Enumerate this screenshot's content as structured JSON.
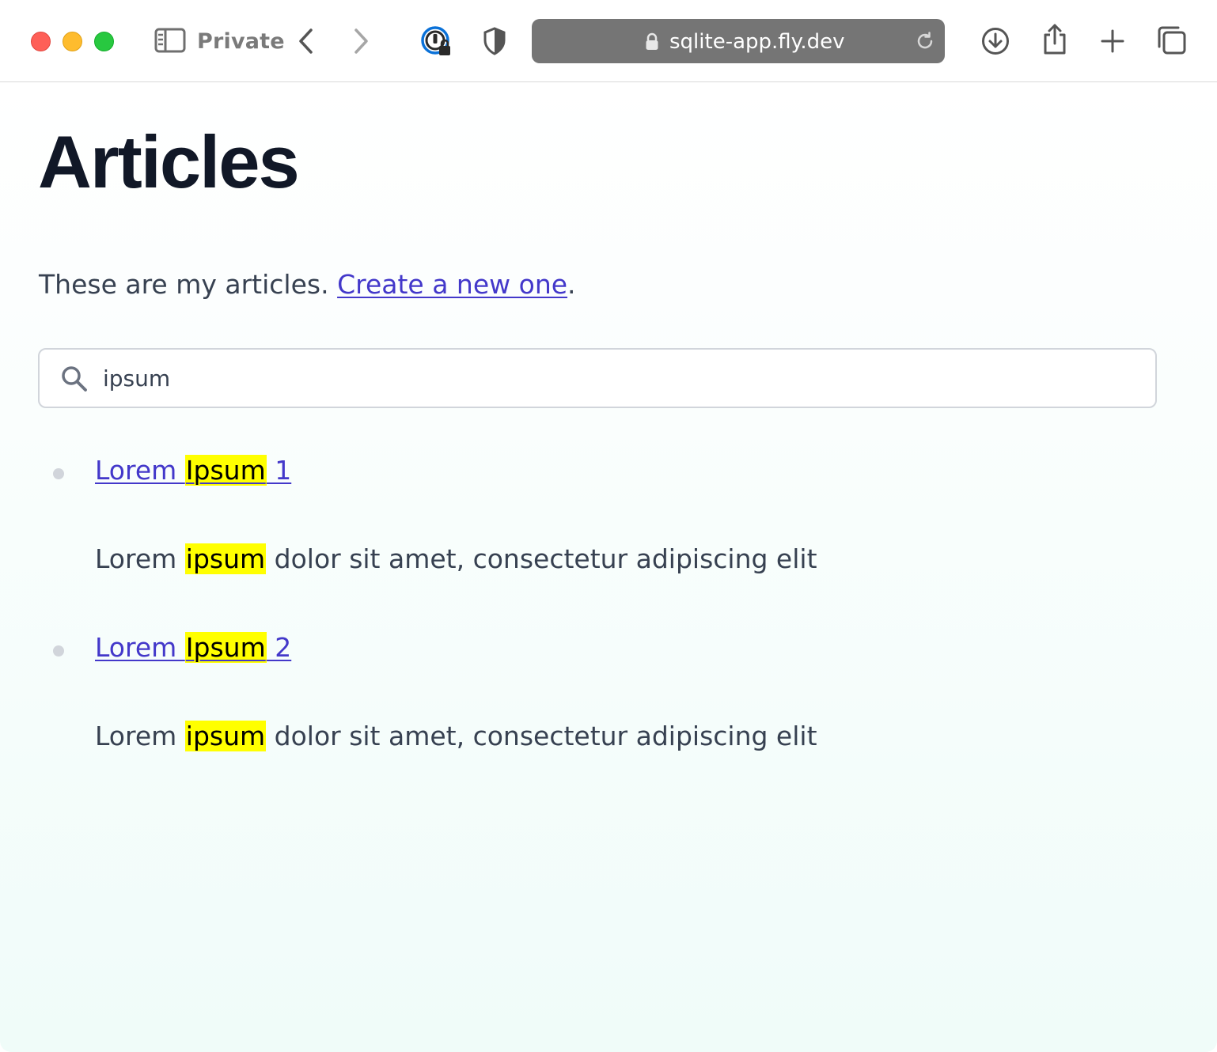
{
  "browser": {
    "private_label": "Private",
    "url": "sqlite-app.fly.dev",
    "icons": {
      "sidebar": "sidebar-icon",
      "back": "chevron-left-icon",
      "forward": "chevron-right-icon",
      "password_manager": "password-lock-icon",
      "privacy": "shield-icon",
      "lock": "lock-icon",
      "reload": "reload-icon",
      "downloads": "download-icon",
      "share": "share-icon",
      "new_tab": "plus-icon",
      "tabs": "tab-overview-icon"
    }
  },
  "page": {
    "title": "Articles",
    "intro_text": "These are my articles. ",
    "intro_link": "Create a new one",
    "intro_end": ".",
    "search": {
      "value": "ipsum",
      "icon": "search-icon"
    },
    "results": [
      {
        "title_before": "Lorem ",
        "title_highlight": "Ipsum",
        "title_after": " 1",
        "snippet_before": "Lorem ",
        "snippet_highlight": "ipsum",
        "snippet_after": " dolor sit amet, consectetur adipiscing elit"
      },
      {
        "title_before": "Lorem ",
        "title_highlight": "Ipsum",
        "title_after": " 2",
        "snippet_before": "Lorem ",
        "snippet_highlight": "ipsum",
        "snippet_after": " dolor sit amet, consectetur adipiscing elit"
      }
    ]
  },
  "colors": {
    "link": "#4338ca",
    "highlight": "#ffff00",
    "heading": "#111827",
    "body_text": "#374151",
    "url_bar": "#757575"
  }
}
